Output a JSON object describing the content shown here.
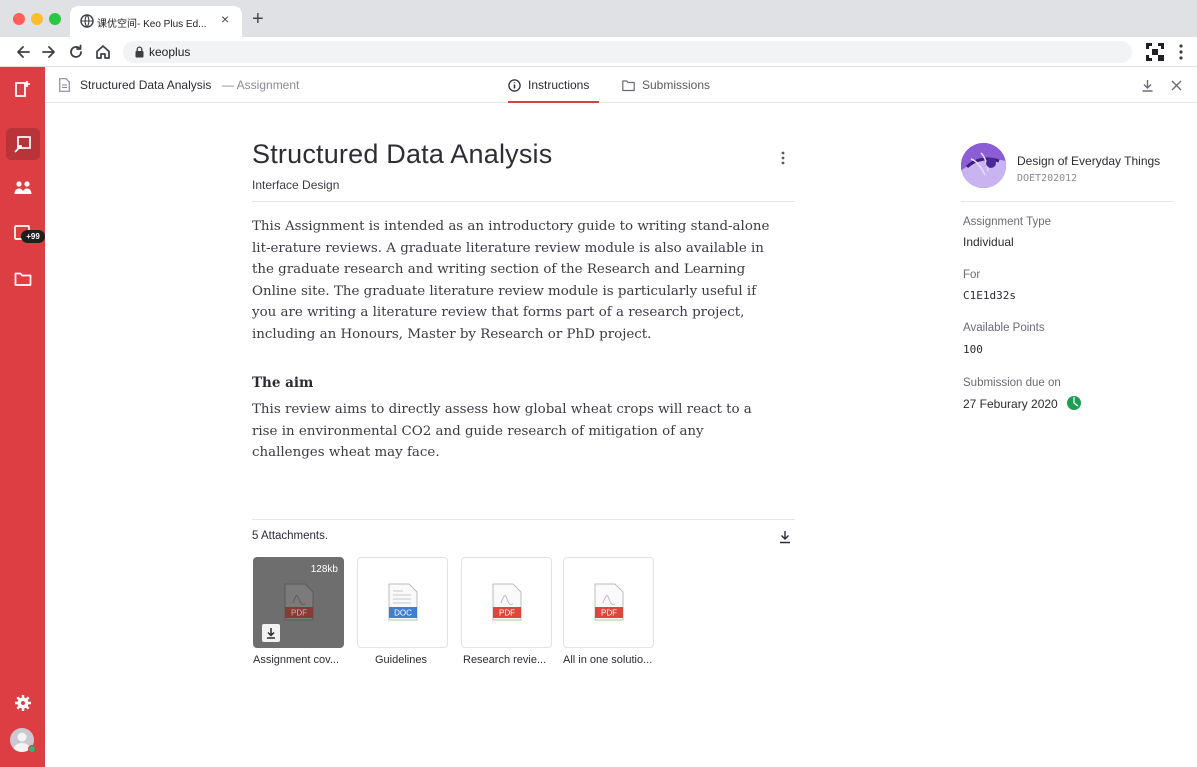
{
  "browser": {
    "tab_title": "课优空间- Keo Plus Ed...",
    "url": "keoplus"
  },
  "sidebar": {
    "badge": "+99"
  },
  "header": {
    "title": "Structured Data Analysis",
    "subtitle": "— Assignment",
    "tabs": [
      {
        "label": "Instructions",
        "active": true
      },
      {
        "label": "Submissions",
        "active": false
      }
    ]
  },
  "assignment": {
    "title": "Structured Data Analysis",
    "course": "Interface Design",
    "intro": "This Assignment is intended as an introductory guide to writing stand-alone lit-erature reviews. A graduate literature review module is also available in the graduate research and writing section of the Research and Learning Online site. The graduate literature review module is particularly useful if you are writing a literature review that forms part of a research project, including an Honours, Master by Research or PhD project.",
    "aim_heading": "The aim",
    "aim_text": "This review aims to directly assess how global wheat crops will react to a rise in environmental CO2 and guide research of mitigation of any challenges wheat may face."
  },
  "attachments": {
    "title": "5 Attachments.",
    "items": [
      {
        "name": "Assignment cov...",
        "type": "PDF",
        "size": "128kb"
      },
      {
        "name": "Guidelines",
        "type": "DOC"
      },
      {
        "name": "Research revie...",
        "type": "PDF"
      },
      {
        "name": "All in one solutio...",
        "type": "PDF"
      }
    ]
  },
  "details": {
    "course_name": "Design of Everyday Things",
    "course_code": "DOET202012",
    "type_label": "Assignment Type",
    "type_value": "Individual",
    "for_label": "For",
    "for_value": "C1E1d32s",
    "points_label": "Available Points",
    "points_value": "100",
    "due_label": "Submission due on",
    "due_value": "27 Feburary 2020"
  },
  "colors": {
    "accent": "#dd3e44",
    "pdf": "#d9483b",
    "doc": "#3f7fd0",
    "status": "#1f9d55"
  }
}
